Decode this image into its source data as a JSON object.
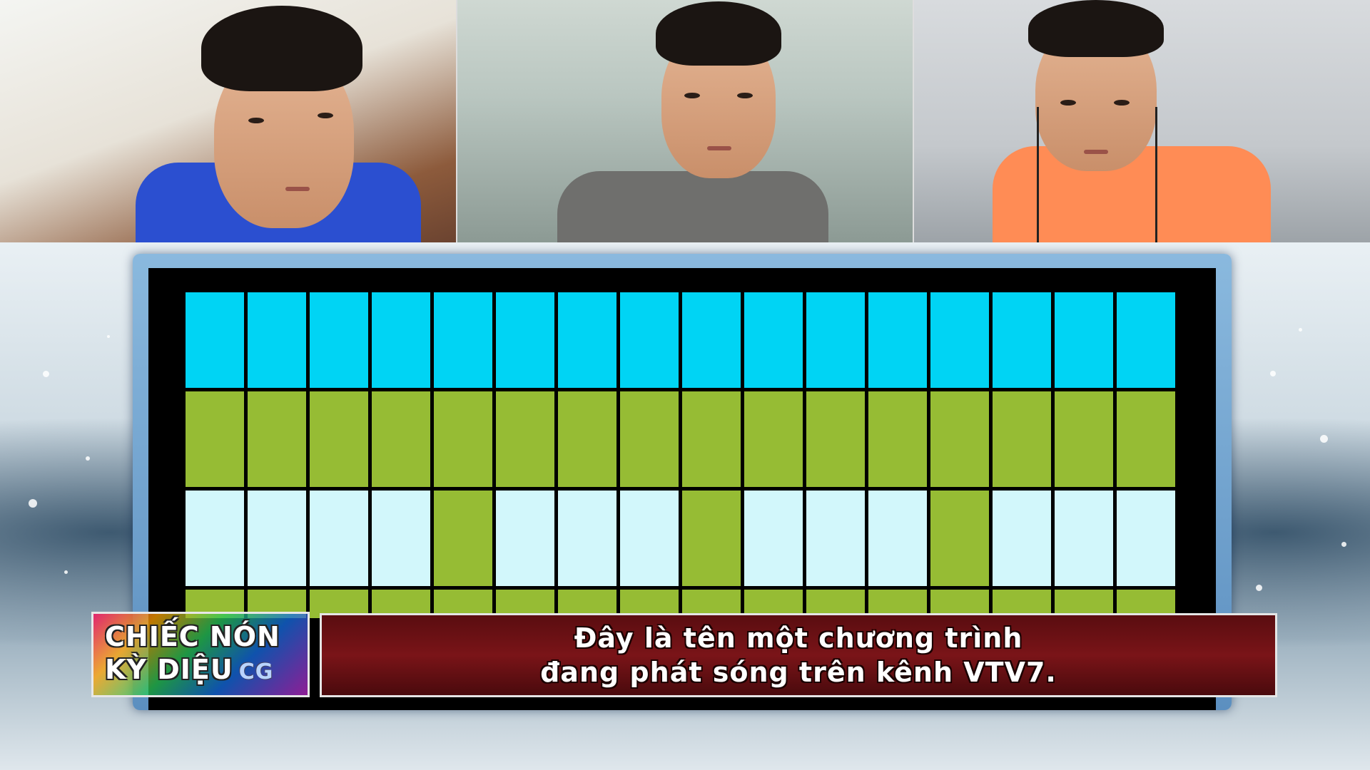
{
  "participants": [
    {
      "name": "",
      "shirt_color": "#2b4fd0"
    },
    {
      "name": "",
      "shirt_color": "#6f6f6d"
    },
    {
      "name": "",
      "shirt_color": "#ff8c55"
    }
  ],
  "board": {
    "columns": 16,
    "rows": [
      [
        "blue",
        "blue",
        "blue",
        "blue",
        "blue",
        "blue",
        "blue",
        "blue",
        "blue",
        "blue",
        "blue",
        "blue",
        "blue",
        "blue",
        "blue",
        "blue"
      ],
      [
        "green",
        "green",
        "green",
        "green",
        "green",
        "green",
        "green",
        "green",
        "green",
        "green",
        "green",
        "green",
        "green",
        "green",
        "green",
        "green"
      ],
      [
        "pale",
        "pale",
        "pale",
        "pale",
        "green",
        "pale",
        "pale",
        "pale",
        "green",
        "pale",
        "pale",
        "pale",
        "green",
        "pale",
        "pale",
        "pale"
      ],
      [
        "green",
        "green",
        "green",
        "green",
        "green",
        "green",
        "green",
        "green",
        "green",
        "green",
        "green",
        "green",
        "green",
        "green",
        "green",
        "green"
      ]
    ],
    "colors": {
      "blue": "#00d4f4",
      "green": "#96bc34",
      "pale": "#d2f7fb"
    }
  },
  "logo": {
    "line1": "CHIẾC NÓN",
    "line2": "KỲ DIỆU",
    "suffix": "CG"
  },
  "caption": {
    "line1": "Đây là tên một chương trình",
    "line2": "đang phát sóng trên kênh VTV7."
  }
}
